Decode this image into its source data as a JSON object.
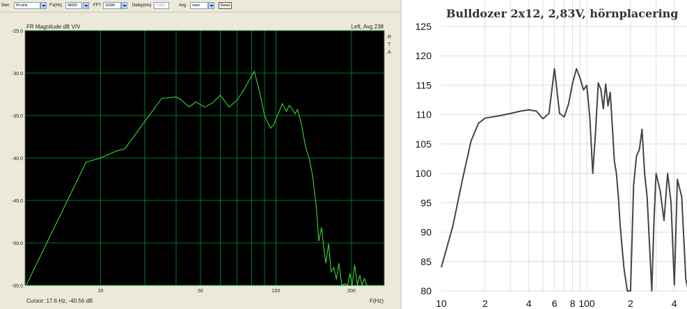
{
  "toolbar": {
    "gen_label": "Gen",
    "gen_value": "Pk pink",
    "fs_label": "Fs(Hz)",
    "fs_value": "48000",
    "fft_label": "FFT",
    "fft_value": "16384",
    "delay_label": "Delay(ms)",
    "delay_value": "0.000",
    "avg_label": "Avg",
    "avg_value": "none",
    "reset_label": "Reset"
  },
  "left_chart": {
    "title": "FR Magnitude dB V/V",
    "channel_label": "Left, Avg 238",
    "side_letters": [
      "R",
      "T",
      "A"
    ],
    "cursor_text": "Cursor:   17.6 Hz, -40.56 dB",
    "xlabel": "F(Hz)",
    "line_color": "#39d739",
    "background": "#000000",
    "grid_color": "#009a3c"
  },
  "right_chart": {
    "title": "Bulldozer 2x12, 2,83V, hörnplacering",
    "line_color": "#444444"
  },
  "chart_data": [
    {
      "type": "line",
      "title": "FR Magnitude dB V/V",
      "xlabel": "F(Hz)",
      "ylabel": "",
      "xscale": "log",
      "xlim": [
        10,
        270
      ],
      "ylim": [
        -55,
        -25
      ],
      "grid": true,
      "x_ticks": [
        {
          "value": 20,
          "label": "20"
        },
        {
          "value": 50,
          "label": "50"
        },
        {
          "value": 100,
          "label": "100"
        },
        {
          "value": 200,
          "label": "200"
        }
      ],
      "y_ticks": [
        {
          "value": -25,
          "label": "-25.0"
        },
        {
          "value": -30,
          "label": "-30.0"
        },
        {
          "value": -35,
          "label": "-35.0"
        },
        {
          "value": -40,
          "label": "-40.0"
        },
        {
          "value": -45,
          "label": "-45.0"
        },
        {
          "value": -50,
          "label": "-50.0"
        },
        {
          "value": -55,
          "label": "-55.0"
        }
      ],
      "series": [
        {
          "x": [
            10.1,
            17.5,
            20,
            23,
            25,
            35,
            40,
            42,
            45,
            48,
            52,
            56,
            60,
            65,
            70,
            75,
            78,
            82,
            86,
            90,
            95,
            98,
            102,
            106,
            110,
            113,
            116,
            119,
            122,
            126,
            131,
            136,
            140,
            145,
            148,
            152,
            155,
            158,
            162,
            166,
            170,
            174,
            178,
            183,
            188,
            193,
            197,
            201,
            206,
            211,
            216,
            220,
            225,
            230,
            235
          ],
          "y": [
            -55,
            -40.5,
            -40,
            -39.2,
            -38.9,
            -33,
            -32.8,
            -33.2,
            -34,
            -33.4,
            -34,
            -33.5,
            -32.6,
            -34,
            -33.2,
            -31.8,
            -30.9,
            -29.8,
            -32.2,
            -35,
            -36.5,
            -36.1,
            -34.8,
            -33.6,
            -34.5,
            -33.8,
            -34.2,
            -34.8,
            -34.3,
            -35.9,
            -38.6,
            -40.2,
            -42.1,
            -46,
            -49.8,
            -48.2,
            -50.5,
            -52.4,
            -50.1,
            -53.4,
            -52.9,
            -54.3,
            -52.4,
            -55,
            -54.8,
            -55,
            -53.6,
            -55,
            -52.6,
            -55,
            -53.8,
            -55,
            -54.2,
            -55,
            -55
          ]
        }
      ]
    },
    {
      "type": "line",
      "title": "Bulldozer 2x12, 2,83V, hörnplacering",
      "xlabel": "",
      "ylabel": "",
      "xscale": "log",
      "xlim": [
        10,
        500
      ],
      "ylim": [
        80,
        125
      ],
      "grid": true,
      "x_ticks": [
        {
          "value": 10,
          "label": "10"
        },
        {
          "value": 20,
          "label": "2"
        },
        {
          "value": 40,
          "label": "4"
        },
        {
          "value": 60,
          "label": "6"
        },
        {
          "value": 80,
          "label": "8"
        },
        {
          "value": 100,
          "label": "100"
        },
        {
          "value": 200,
          "label": "2"
        },
        {
          "value": 400,
          "label": "4"
        }
      ],
      "y_ticks": [
        {
          "value": 80,
          "label": "80"
        },
        {
          "value": 85,
          "label": "85"
        },
        {
          "value": 90,
          "label": "90"
        },
        {
          "value": 95,
          "label": "95"
        },
        {
          "value": 100,
          "label": "100"
        },
        {
          "value": 105,
          "label": "105"
        },
        {
          "value": 110,
          "label": "110"
        },
        {
          "value": 115,
          "label": "115"
        },
        {
          "value": 120,
          "label": "120"
        },
        {
          "value": 125,
          "label": "125"
        }
      ],
      "series": [
        {
          "x": [
            10,
            12,
            14,
            16,
            18,
            20,
            25,
            30,
            35,
            40,
            45,
            50,
            55,
            60,
            65,
            70,
            75,
            80,
            85,
            90,
            95,
            100,
            105,
            110,
            115,
            120,
            125,
            130,
            135,
            140,
            145,
            150,
            155,
            160,
            165,
            170,
            180,
            190,
            200,
            210,
            220,
            230,
            240,
            250,
            260,
            270,
            280,
            290,
            300,
            320,
            340,
            360,
            380,
            400,
            420,
            450,
            480,
            500
          ],
          "y": [
            84,
            91,
            99,
            105.5,
            108.5,
            109.4,
            109.8,
            110.2,
            110.6,
            110.8,
            110.6,
            109.3,
            110.2,
            117.8,
            110.2,
            109.6,
            111.8,
            115.4,
            117.8,
            116.2,
            114.2,
            115,
            109.5,
            100,
            107,
            115.4,
            114.3,
            111,
            115.2,
            111.5,
            113.8,
            108.1,
            102,
            100,
            96,
            91,
            84,
            80,
            80,
            98,
            103,
            104,
            107.5,
            100,
            96,
            88,
            80,
            92,
            100,
            97,
            92,
            100,
            95,
            81,
            99,
            96,
            82,
            80
          ]
        }
      ]
    }
  ]
}
